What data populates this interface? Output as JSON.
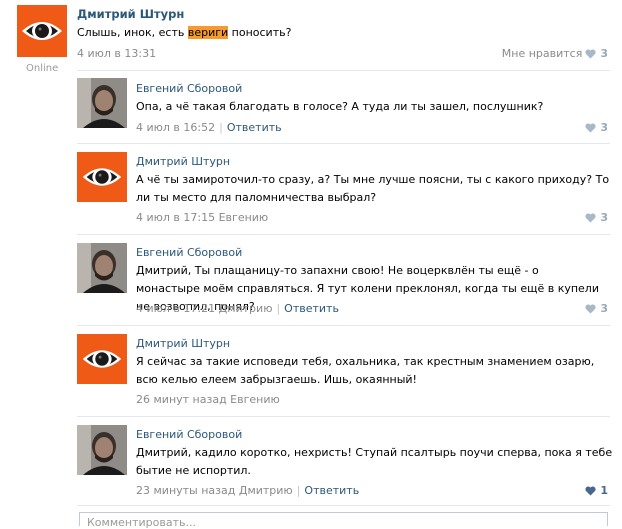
{
  "post": {
    "author": "Дмитрий Штурн",
    "text_before": "Слышь, инок, есть ",
    "text_highlight": "вериги",
    "text_after": " поносить?",
    "date": "4 июл в 13:31",
    "like_label": "Мне нравится",
    "like_count": "3",
    "online": "Online"
  },
  "comments": [
    {
      "author": "Евгений Сборовой",
      "text": "Опа, а чё такая благодать в голосе? А туда ли ты зашел, послушник?",
      "date": "4 июл в 16:52",
      "reply_label": "Ответить",
      "likes": "3"
    },
    {
      "author": "Дмитрий Штурн",
      "text": "А чё ты замироточил-то сразу, а? Ты мне лучше поясни, ты с какого приходу? То ли ты место для паломничества выбрал?",
      "date": "4 июл в 17:15 Евгению",
      "likes": "3"
    },
    {
      "author": "Евгений Сборовой",
      "text": "Дмитрий, Ты плащаницу-то запахни свою! Не воцерквлён ты ещё - о монастыре моём справляться. Я тут колени преклонял, когда ты ещё в купели не возвопил, понял?",
      "date": "4 июл в 17:21 Дмитрию",
      "reply_label": "Ответить",
      "likes": "3"
    },
    {
      "author": "Дмитрий Штурн",
      "text": "Я сейчас за такие исповеди тебя, охальника, так крестным знамением озарю, всю келью елеем забрызгаешь. Ишь, окаянный!",
      "date": "26 минут назад Евгению"
    },
    {
      "author": "Евгений Сборовой",
      "text": "Дмитрий, кадило коротко, нехристь! Ступай псалтырь поучи сперва, пока я тебе бытие не испортил.",
      "date": "23 минуты назад Дмитрию",
      "reply_label": "Ответить",
      "likes": "1"
    }
  ],
  "comment_input": {
    "placeholder": "Комментировать..."
  },
  "colors": {
    "link": "#2b587a",
    "avatar_orange": "#ef5b17",
    "highlight": "#f59a2b"
  }
}
